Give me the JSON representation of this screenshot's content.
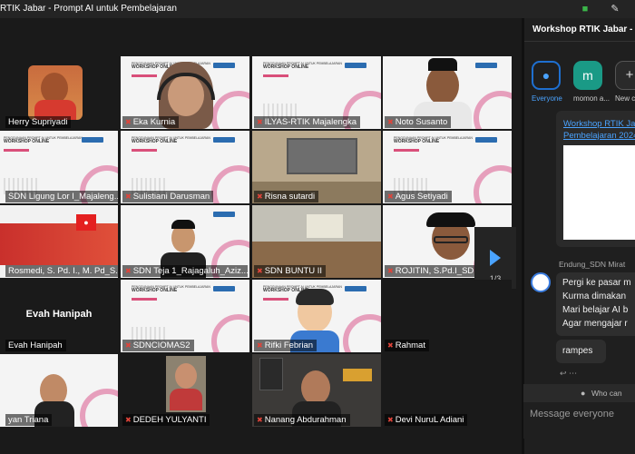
{
  "window": {
    "title": "RTIK Jabar - Prompt AI untuk Pembelajaran"
  },
  "gallery": {
    "page_indicator": "1/3",
    "tiles": [
      {
        "name": "Herry Supriyadi",
        "muted": false
      },
      {
        "name": "Eka Kurnia",
        "muted": true
      },
      {
        "name": "ILYAS-RTIK Majalengka",
        "muted": true
      },
      {
        "name": "Noto Susanto",
        "muted": true
      },
      {
        "name": "SDN Ligung Lor I_Majaleng...",
        "muted": false
      },
      {
        "name": "Sulistiani Darusman",
        "muted": true
      },
      {
        "name": "Risna sutardi",
        "muted": true
      },
      {
        "name": "Agus Setiyadi",
        "muted": true
      },
      {
        "name": "Rosmedi, S. Pd. I., M. Pd_S...",
        "muted": false
      },
      {
        "name": "SDN Teja 1_Rajagaluh_Aziz...",
        "muted": true
      },
      {
        "name": "SDN BUNTU II",
        "muted": true
      },
      {
        "name": "ROJITIN, S.Pd.I_SDN ...",
        "muted": true
      },
      {
        "name": "Evah Hanipah",
        "muted": false,
        "center_label": "Evah Hanipah"
      },
      {
        "name": "SDNCIOMAS2",
        "muted": true
      },
      {
        "name": "Rifki Febrian",
        "muted": true
      },
      {
        "name": "Rahmat",
        "muted": true
      },
      {
        "name": "yan Triana",
        "muted": false
      },
      {
        "name": "DEDEH YULYANTI",
        "muted": true
      },
      {
        "name": "Nanang Abdurahman",
        "muted": true
      },
      {
        "name": "Devi NuruL Adiani",
        "muted": true
      }
    ],
    "slide": {
      "header_small": "PENGGUNAAN PROMPT AI UNTUK PEMBELAJARAN",
      "header_big": "WORKSHOP ONLINE"
    }
  },
  "chat": {
    "header": "Workshop RTIK Jabar - P",
    "recipients": [
      {
        "label": "Everyone",
        "initial": "",
        "color": "#1e6fd0"
      },
      {
        "label": "momon a...",
        "initial": "m",
        "color": "#1a9a86"
      },
      {
        "label": "New c",
        "initial": "+",
        "color": "#2a2a2a"
      }
    ],
    "link_line1": "Workshop RTIK Ja",
    "link_line2": "Pembelajaran 2024",
    "sender": "Endung_SDN Mirat",
    "message_lines": [
      "Pergi ke pasar m",
      "Kurma dimakan",
      "Mari belajar AI b",
      "Agar mengajar r"
    ],
    "message2": "rampes",
    "who_can": "Who can",
    "input_placeholder": "Message everyone"
  },
  "colors": {
    "accent": "#4aa3ff",
    "muted_mic": "#e0443a",
    "chat_bg": "#1f1f1f",
    "gallery_bg": "#1a1a1a"
  }
}
